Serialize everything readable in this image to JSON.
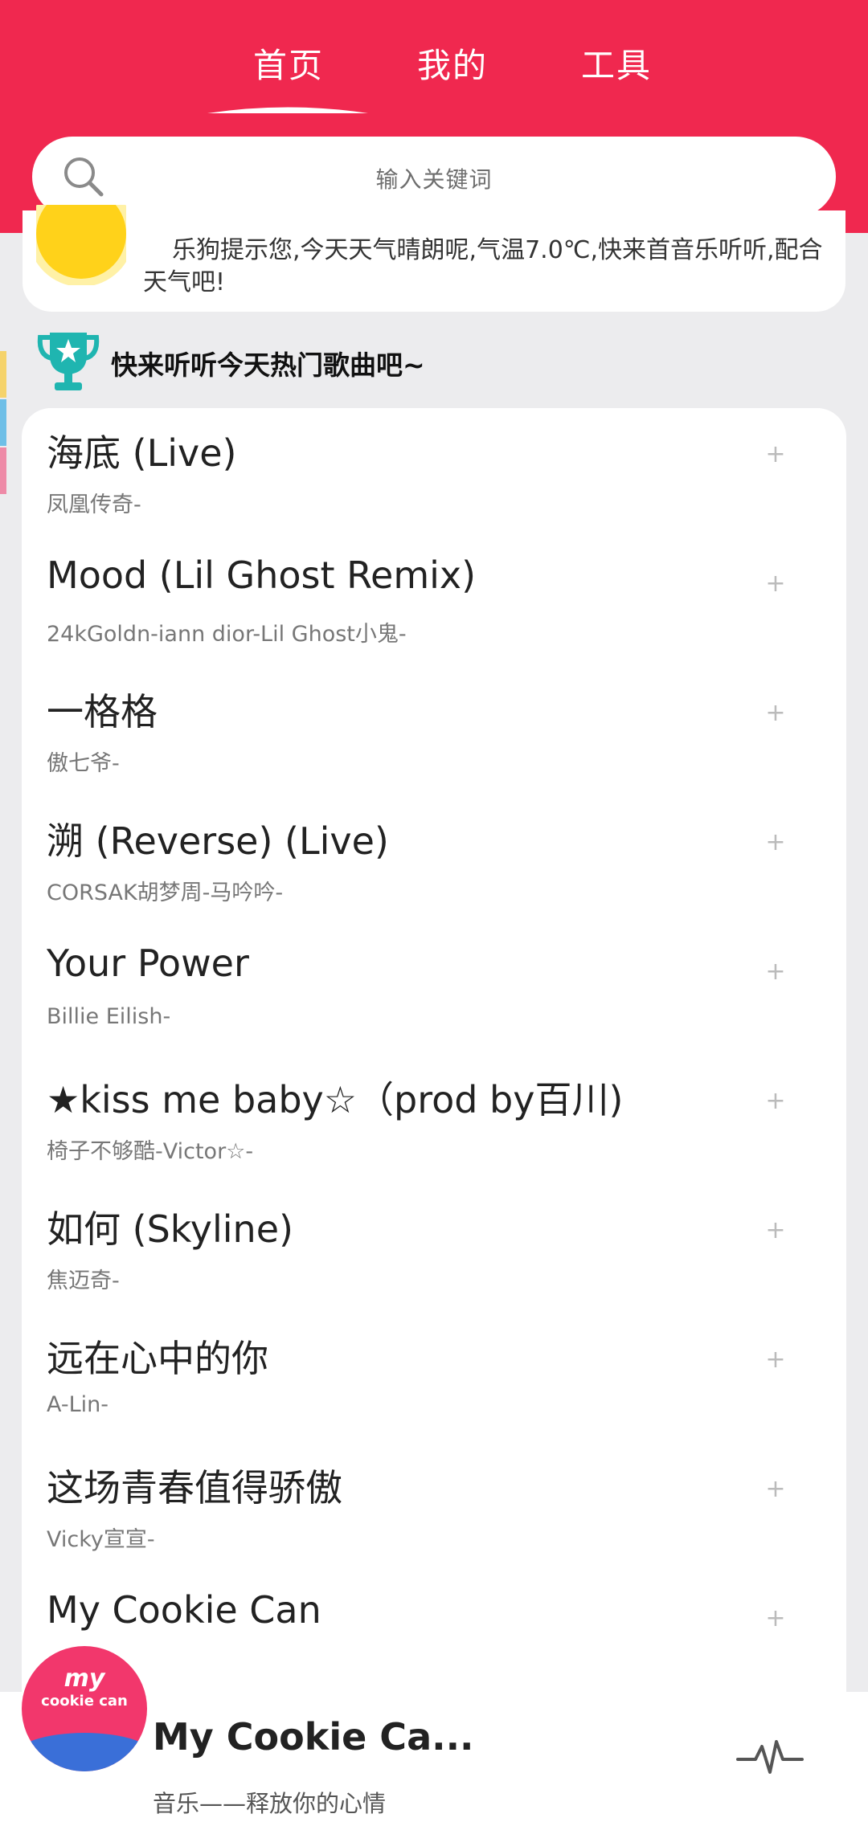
{
  "tabs": [
    {
      "label": "首页"
    },
    {
      "label": "我的"
    },
    {
      "label": "工具"
    }
  ],
  "search": {
    "placeholder": "输入关键词"
  },
  "weather": {
    "message": "乐狗提示您,今天天气晴朗呢,气温7.0℃,快来首音乐听听,配合天气吧!"
  },
  "hot_section": {
    "title": "快来听听今天热门歌曲吧~"
  },
  "songs": [
    {
      "title": "海底 (Live)",
      "artist": "凤凰传奇-",
      "action": "+"
    },
    {
      "title": "Mood (Lil Ghost Remix)",
      "artist": "24kGoldn-iann dior-Lil Ghost小鬼-",
      "action": "+"
    },
    {
      "title": "一格格",
      "artist": "傲七爷-",
      "action": "+"
    },
    {
      "title": "溯 (Reverse) (Live)",
      "artist": "CORSAK胡梦周-马吟吟-",
      "action": "+"
    },
    {
      "title": "Your Power",
      "artist": "Billie Eilish-",
      "action": "+"
    },
    {
      "title": "★kiss me baby☆（prod by百川)",
      "artist": "椅子不够酷-Victor☆-",
      "action": "+"
    },
    {
      "title": "如何 (Skyline)",
      "artist": "焦迈奇-",
      "action": "+"
    },
    {
      "title": "远在心中的你",
      "artist": "A-Lin-",
      "action": "+"
    },
    {
      "title": "这场青春值得骄傲",
      "artist": "Vicky宣宣-",
      "action": "+"
    },
    {
      "title": "My Cookie Can",
      "artist": "",
      "action": "+"
    }
  ],
  "player": {
    "title": "My Cookie Ca...",
    "subtitle": "音乐——释放你的心情",
    "art_text": "my",
    "art_text2": "cookie can"
  },
  "colors": {
    "header": "#f0284f",
    "background": "#ececee",
    "sun": "#ffd21a",
    "trophy": "#1fb5b0"
  }
}
